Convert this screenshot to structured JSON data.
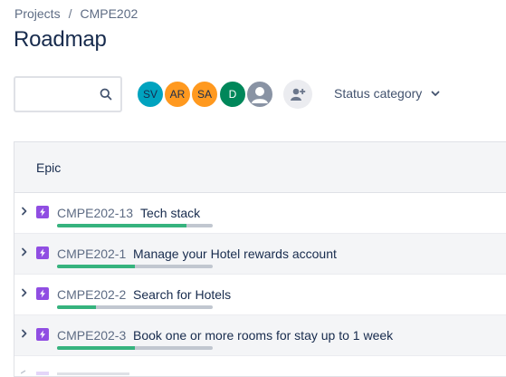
{
  "breadcrumb": {
    "projects": "Projects",
    "separator": "/",
    "project": "CMPE202"
  },
  "page": {
    "title": "Roadmap"
  },
  "search": {
    "value": "",
    "placeholder": "",
    "icon": "search-icon"
  },
  "avatars": [
    {
      "initials": "SV",
      "color": "#00a3bf"
    },
    {
      "initials": "AR",
      "color": "#ff991f"
    },
    {
      "initials": "SA",
      "color": "#ff991f"
    },
    {
      "initials": "D",
      "color": "#00875a",
      "text_color": "#ffffff"
    },
    {
      "initials": "",
      "color": "#8993a4",
      "icon": "default-user-icon"
    }
  ],
  "add_people": {
    "icon": "add-person-icon"
  },
  "filters": {
    "status_category": "Status category",
    "icon": "chevron-down-icon"
  },
  "table": {
    "header": "Epic",
    "rows": [
      {
        "key": "CMPE202-13",
        "summary": "Tech stack",
        "progress": 0.83
      },
      {
        "key": "CMPE202-1",
        "summary": "Manage your Hotel rewards account",
        "progress": 0.5
      },
      {
        "key": "CMPE202-2",
        "summary": "Search for Hotels",
        "progress": 0.25
      },
      {
        "key": "CMPE202-3",
        "summary": "Book one or more rooms for stay up to 1 week",
        "progress": 0.5
      }
    ]
  },
  "colors": {
    "epic_purple": "#904ee2",
    "progress_done": "#36b37e",
    "progress_track": "#c1c7d0",
    "text_primary": "#172b4d",
    "text_subtle": "#5e6c84"
  }
}
